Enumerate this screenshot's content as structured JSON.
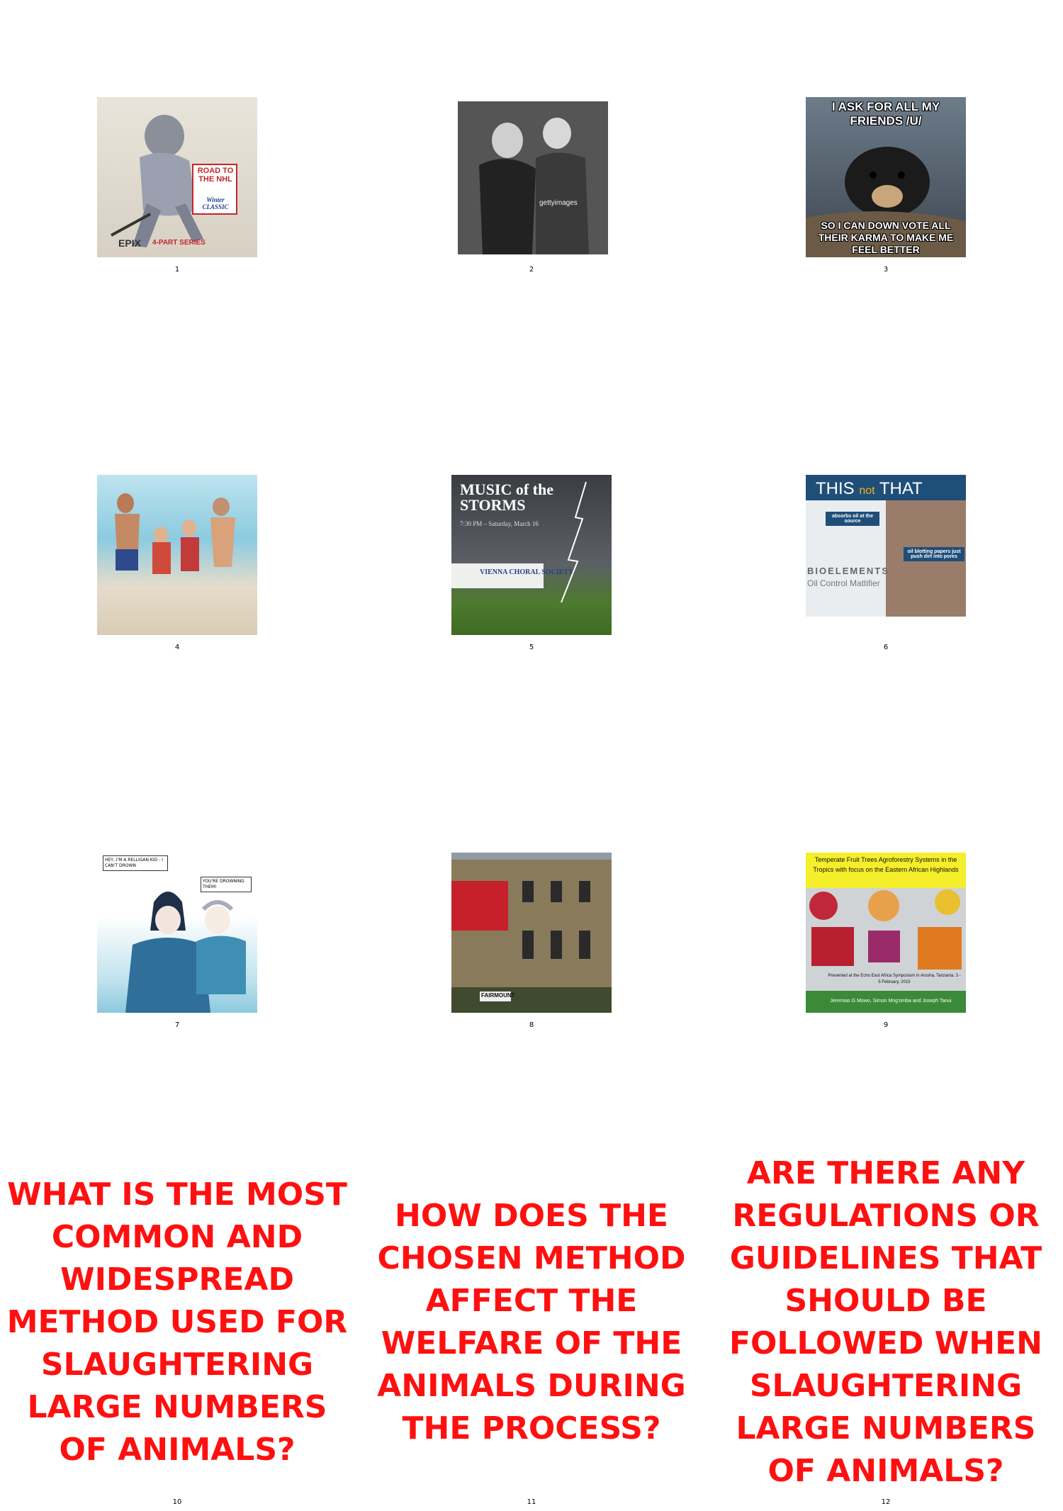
{
  "cells": [
    {
      "number": "1",
      "kind": "image",
      "icon": "hockey-poster",
      "texts": {
        "a": "ROAD TO THE NHL",
        "b": "Winter CLASSIC",
        "c": "EPIX",
        "d": "4-PART SERIES"
      }
    },
    {
      "number": "2",
      "kind": "image",
      "icon": "vintage-photo",
      "texts": {
        "a": "gettyimages"
      }
    },
    {
      "number": "3",
      "kind": "image",
      "icon": "confession-bear-meme",
      "texts": {
        "top": "I ASK FOR ALL MY FRIENDS /U/",
        "bottom": "SO I CAN DOWN VOTE ALL THEIR KARMA TO MAKE ME FEEL BETTER"
      }
    },
    {
      "number": "4",
      "kind": "image",
      "icon": "beach-family-photo",
      "texts": {}
    },
    {
      "number": "5",
      "kind": "image",
      "icon": "concert-poster",
      "texts": {
        "a": "MUSIC of the STORMS",
        "b": "7:30 PM – Saturday, March 16",
        "c": "VIENNA CHORAL SOCIETY"
      }
    },
    {
      "number": "6",
      "kind": "image",
      "icon": "skincare-ad",
      "texts": {
        "a": "THIS",
        "b": "not",
        "c": "THAT",
        "d": "absorbs oil at the source",
        "e": "oil blotting papers just push dirt into pores",
        "f": "BIOELEMENTS",
        "g": "Oil Control Mattifier"
      }
    },
    {
      "number": "7",
      "kind": "image",
      "icon": "comic-illustration",
      "texts": {
        "a": "HEY, I'M A RELLIGAN KID - I CAN'T DROWN",
        "b": "YOU'RE DROWNING THEM!"
      }
    },
    {
      "number": "8",
      "kind": "image",
      "icon": "building-photo",
      "texts": {
        "a": "FAIRMOUNT"
      }
    },
    {
      "number": "9",
      "kind": "image",
      "icon": "agroforestry-slide",
      "texts": {
        "a": "Temperate Fruit Trees Agroforestry Systems in the Tropics with focus on the Eastern African Highlands",
        "b": "Presented at the Echo East Africa Symposium in Arusha, Tanzania. 3 - 5 February, 2015",
        "c": "Jeremias G Mowo, Simon Mng'omba and Joseph Tanui"
      }
    },
    {
      "number": "10",
      "kind": "text",
      "text": "WHAT IS THE MOST COMMON AND WIDESPREAD METHOD USED FOR SLAUGHTERING LARGE NUMBERS OF ANIMALS?"
    },
    {
      "number": "11",
      "kind": "text",
      "text": "HOW DOES THE CHOSEN METHOD AFFECT THE WELFARE OF THE ANIMALS DURING THE PROCESS?"
    },
    {
      "number": "12",
      "kind": "text",
      "text": "ARE THERE ANY REGULATIONS OR GUIDELINES THAT SHOULD BE FOLLOWED WHEN SLAUGHTERING LARGE NUMBERS OF ANIMALS?"
    }
  ],
  "colors": {
    "question_text": "#ff1010",
    "background": "#ffffff"
  }
}
